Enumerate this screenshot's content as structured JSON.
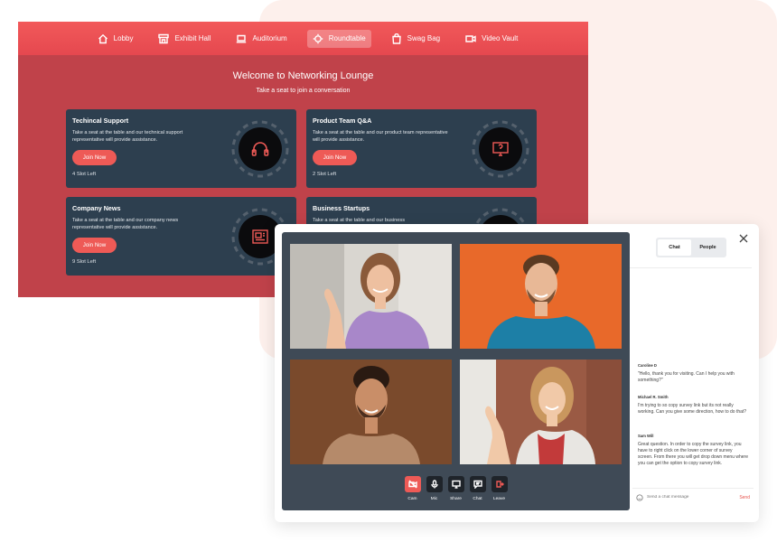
{
  "nav": [
    {
      "label": "Lobby",
      "icon": "home-icon"
    },
    {
      "label": "Exhibit Hall",
      "icon": "store-icon"
    },
    {
      "label": "Auditorium",
      "icon": "laptop-icon"
    },
    {
      "label": "Roundtable",
      "icon": "roundtable-icon",
      "active": true
    },
    {
      "label": "Swag Bag",
      "icon": "bag-icon"
    },
    {
      "label": "Video Vault",
      "icon": "video-icon"
    }
  ],
  "lounge": {
    "title": "Welcome to Networking Lounge",
    "subtitle": "Take a seat to join a conversation"
  },
  "rooms": [
    {
      "title": "Techincal Support",
      "description": "Take a seat at the table and our technical support representative will provide assistance.",
      "button": "Join Now",
      "slots": "4 Slot Left",
      "icon": "headphones-icon"
    },
    {
      "title": "Product Team Q&A",
      "description": "Take a seat at the table and our product team representative will provide assistance.",
      "button": "Join Now",
      "slots": "2 Slot Left",
      "icon": "question-screen-icon"
    },
    {
      "title": "Company News",
      "description": "Take a seat at the table and our company news representative will provide assistance.",
      "button": "Join Now",
      "slots": "9 Slot Left",
      "icon": "newspaper-icon"
    },
    {
      "title": "Business Startups",
      "description": "Take a seat at the table and our business",
      "button": "",
      "slots": "",
      "icon": "startup-icon"
    }
  ],
  "controls": [
    {
      "label": "Cam",
      "icon": "camera-off-icon"
    },
    {
      "label": "Mic",
      "icon": "mic-icon"
    },
    {
      "label": "Share",
      "icon": "share-screen-icon"
    },
    {
      "label": "Chat",
      "icon": "chat-icon"
    },
    {
      "label": "Leave",
      "icon": "leave-icon"
    }
  ],
  "chat": {
    "tabs": [
      "Chat",
      "People"
    ],
    "messages": [
      {
        "name": "Caroline D",
        "text": "\"Hello, thank you for visiting. Can I help you with something?\""
      },
      {
        "name": "Michael R. Smith",
        "text": "I'm trying to so copy survey link but its not really working. Can you give some direction, how to do that?"
      },
      {
        "name": "Sam Will",
        "text": "Great question. In order to copy the survey link, you have to right click on the lower corner of survey screen. From there you will get drop down menu where you can get the option to copy survey link."
      }
    ],
    "input_placeholder": "Send a chat message",
    "send_label": "Send"
  },
  "colors": {
    "lounge_bg": "#c0424a",
    "nav_gradient": "#f2595a",
    "card_bg": "#2d3f4f",
    "accent": "#ee5a56",
    "video_panel": "#3f4a56"
  }
}
